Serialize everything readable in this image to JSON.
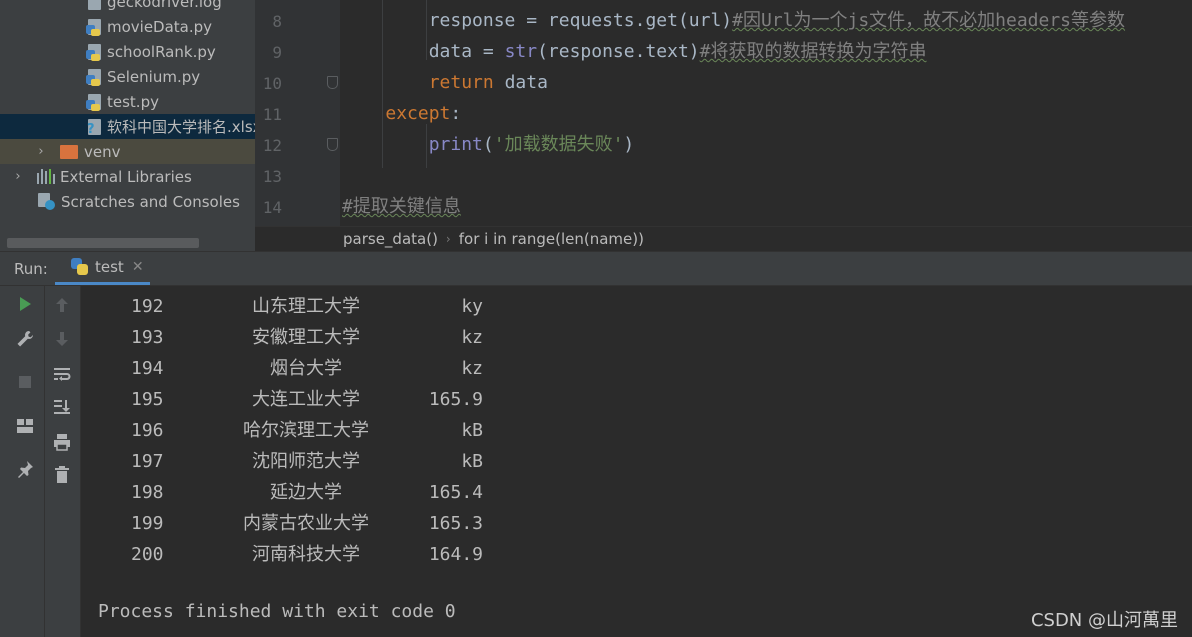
{
  "project_tree": {
    "files": [
      {
        "name": "geckodriver.log",
        "kind": "log"
      },
      {
        "name": "movieData.py",
        "kind": "py"
      },
      {
        "name": "schoolRank.py",
        "kind": "py"
      },
      {
        "name": "Selenium.py",
        "kind": "py"
      },
      {
        "name": "test.py",
        "kind": "py"
      },
      {
        "name": "软科中国大学排名.xlsx",
        "kind": "unknown"
      }
    ],
    "venv_label": "venv",
    "external_libraries_label": "External Libraries",
    "scratches_label": "Scratches and Consoles"
  },
  "editor": {
    "line_numbers": [
      "8",
      "9",
      "10",
      "11",
      "12",
      "13",
      "14"
    ],
    "lines": [
      {
        "indent": "        ",
        "tokens": [
          {
            "t": "response = requests.get(url)",
            "c": "plain"
          },
          {
            "t": "#因Url为一个js文件，故不必加headers等参数",
            "c": "comment"
          }
        ]
      },
      {
        "indent": "        ",
        "tokens": [
          {
            "t": "data = ",
            "c": "plain"
          },
          {
            "t": "str",
            "c": "builtin"
          },
          {
            "t": "(response.text)",
            "c": "plain"
          },
          {
            "t": "#将获取的数据转换为字符串",
            "c": "comment"
          }
        ]
      },
      {
        "indent": "        ",
        "tokens": [
          {
            "t": "return",
            "c": "keyword"
          },
          {
            "t": " data",
            "c": "plain"
          }
        ]
      },
      {
        "indent": "    ",
        "tokens": [
          {
            "t": "except",
            "c": "keyword"
          },
          {
            "t": ":",
            "c": "plain"
          }
        ]
      },
      {
        "indent": "        ",
        "tokens": [
          {
            "t": "print",
            "c": "builtin"
          },
          {
            "t": "(",
            "c": "plain"
          },
          {
            "t": "'加载数据失败'",
            "c": "string"
          },
          {
            "t": ")",
            "c": "plain"
          }
        ]
      },
      {
        "indent": "",
        "tokens": []
      },
      {
        "indent": "",
        "tokens": [
          {
            "t": "#提取关键信息",
            "c": "comment"
          }
        ]
      }
    ],
    "breadcrumb": [
      "parse_data()",
      "for i in range(len(name))"
    ]
  },
  "run_panel": {
    "label": "Run:",
    "tab_label": "test",
    "output_rows": [
      {
        "rank": "192",
        "name": "山东理工大学",
        "score": "ky"
      },
      {
        "rank": "193",
        "name": "安徽理工大学",
        "score": "kz"
      },
      {
        "rank": "194",
        "name": "烟台大学",
        "score": "kz"
      },
      {
        "rank": "195",
        "name": "大连工业大学",
        "score": "165.9"
      },
      {
        "rank": "196",
        "name": "哈尔滨理工大学",
        "score": "kB"
      },
      {
        "rank": "197",
        "name": "沈阳师范大学",
        "score": "kB"
      },
      {
        "rank": "198",
        "name": "延边大学",
        "score": "165.4"
      },
      {
        "rank": "199",
        "name": "内蒙古农业大学",
        "score": "165.3"
      },
      {
        "rank": "200",
        "name": "河南科技大学",
        "score": "164.9"
      }
    ],
    "exit_message": "Process finished with exit code 0"
  },
  "watermark": "CSDN @山河萬里",
  "colors": {
    "accent": "#4a88c7",
    "run_green": "#499c54",
    "keyword": "#cc7832",
    "string": "#6a8759",
    "comment": "#808080"
  }
}
